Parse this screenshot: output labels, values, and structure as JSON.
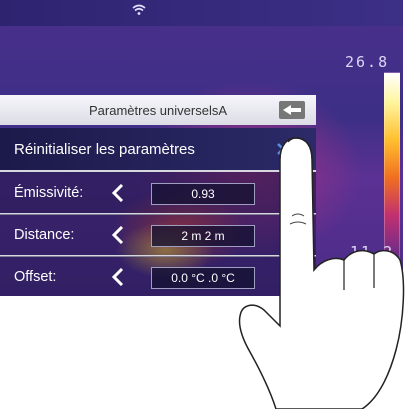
{
  "menu": {
    "title": "Paramètres universelsA",
    "reset_label": "Réinitialiser les paramètres",
    "rows": [
      {
        "label": "Émissivité:",
        "value": "0.93"
      },
      {
        "label": "Distance:",
        "value": "2 m 2 m"
      },
      {
        "label": "Offset:",
        "value": "0.0 °C  .0 °C"
      }
    ]
  },
  "scale": {
    "max": "26.8",
    "min": "11.2"
  },
  "icons": {
    "status": "wifi-icon",
    "back": "back-arrow-icon",
    "close": "close-icon",
    "left": "chevron-left-icon"
  },
  "colors": {
    "menu_bg": "#1c1a4a",
    "thermal_bg": "#3d2f86"
  }
}
